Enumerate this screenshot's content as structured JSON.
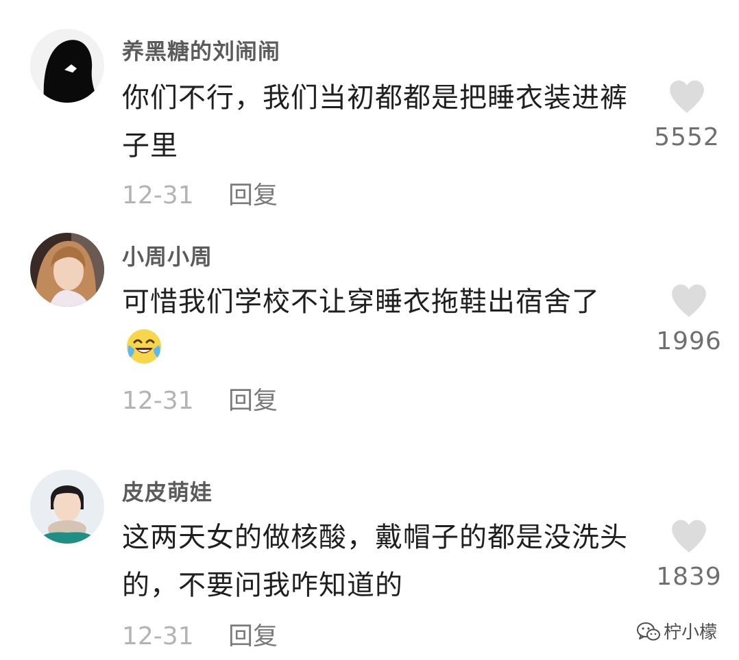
{
  "comments": [
    {
      "username": "养黑糖的刘闹闹",
      "text": "你们不行，我们当初都都是把睡衣装进裤子里",
      "date": "12-31",
      "reply_label": "回复",
      "likes": "5552"
    },
    {
      "username": "小周小周",
      "text": "可惜我们学校不让穿睡衣拖鞋出宿舍了",
      "emoji": "laugh-crying-emoji",
      "date": "12-31",
      "reply_label": "回复",
      "likes": "1996"
    },
    {
      "username": "皮皮萌娃",
      "text": "这两天女的做核酸，戴帽子的都是没洗头的，不要问我咋知道的",
      "date": "12-31",
      "reply_label": "回复",
      "likes": "1839"
    }
  ],
  "watermark": {
    "icon": "wechat-icon",
    "text": "柠小檬"
  },
  "colors": {
    "username": "#5b5b5b",
    "text": "#1f1f1f",
    "meta": "#b3b3b3",
    "heart": "#dcdcdc"
  }
}
